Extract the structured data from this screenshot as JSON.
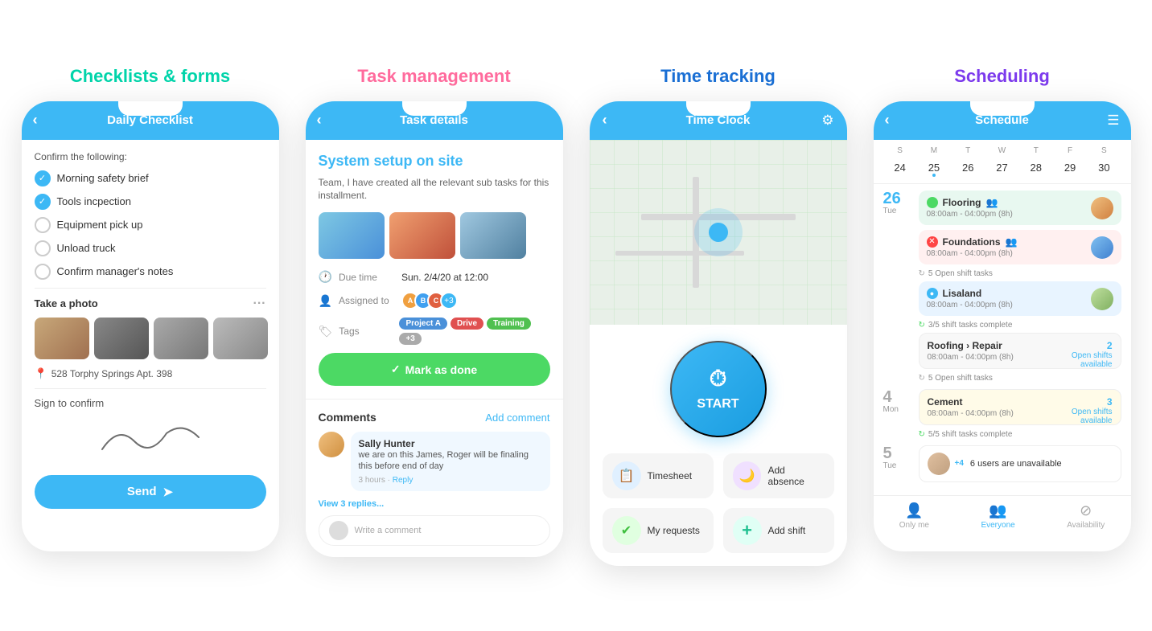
{
  "sections": [
    {
      "id": "checklists",
      "title": "Checklists & forms",
      "titleClass": "title-checklists",
      "phone": {
        "headerTitle": "Daily Checklist",
        "confirmLabel": "Confirm the following:",
        "checkItems": [
          {
            "text": "Morning safety brief",
            "checked": true
          },
          {
            "text": "Tools incpection",
            "checked": true
          },
          {
            "text": "Equipment pick up",
            "checked": false
          },
          {
            "text": "Unload truck",
            "checked": false
          },
          {
            "text": "Confirm manager's notes",
            "checked": false
          }
        ],
        "takePhotoLabel": "Take a photo",
        "locationText": "528 Torphy Springs Apt. 398",
        "signLabel": "Sign to confirm",
        "sendLabel": "Send"
      }
    },
    {
      "id": "task",
      "title": "Task management",
      "titleClass": "title-task",
      "phone": {
        "headerTitle": "Task details",
        "taskTitle": "System setup on site",
        "taskDesc": "Team, I have created all the relevant sub tasks for this installment.",
        "dueLabel": "Due time",
        "dueValue": "Sun. 2/4/20 at 12:00",
        "assignedLabel": "Assigned to",
        "tagsLabel": "Tags",
        "tags": [
          "Project A",
          "Drive",
          "Training",
          "+3"
        ],
        "markDoneLabel": "Mark as done",
        "commentsTitle": "Comments",
        "addCommentLabel": "Add comment",
        "comment": {
          "name": "Sally Hunter",
          "text": "we are on this James, Roger will be finaling this before end of day",
          "time": "3 hours",
          "replyLabel": "Reply",
          "viewReplies": "View 3 replies..."
        },
        "writePlaceholder": "Write a comment"
      }
    },
    {
      "id": "timetracking",
      "title": "Time tracking",
      "titleClass": "title-time",
      "phone": {
        "headerTitle": "Time Clock",
        "startLabel": "START",
        "actions": [
          {
            "label": "Timesheet",
            "iconClass": "icon-blue-light",
            "icon": "📋"
          },
          {
            "label": "Add absence",
            "iconClass": "icon-purple-light",
            "icon": "🌙"
          },
          {
            "label": "My requests",
            "iconClass": "icon-green-light",
            "icon": "✔"
          },
          {
            "label": "Add shift",
            "iconClass": "icon-teal-light",
            "icon": "+"
          }
        ]
      }
    },
    {
      "id": "scheduling",
      "title": "Scheduling",
      "titleClass": "title-scheduling",
      "phone": {
        "headerTitle": "Schedule",
        "calDays": [
          "S",
          "M",
          "T",
          "W",
          "T",
          "F",
          "S"
        ],
        "calDates": [
          {
            "num": "24",
            "dot": false
          },
          {
            "num": "25",
            "dot": true
          },
          {
            "num": "26",
            "dot": false,
            "today": true
          },
          {
            "num": "27",
            "dot": false
          },
          {
            "num": "28",
            "dot": false
          },
          {
            "num": "29",
            "dot": false
          },
          {
            "num": "30",
            "dot": false
          }
        ],
        "scheduleDate": "26",
        "scheduleDateDay": "Tue",
        "scheduleItems": [
          {
            "title": "Flooring",
            "group": "👥",
            "time": "08:00am - 04:00pm (8h)",
            "status": "green",
            "hasAvatar": true
          },
          {
            "title": "Foundations",
            "group": "👥",
            "time": "08:00am - 04:00pm (8h)",
            "status": "red",
            "hasAvatar": true
          },
          {
            "tasks": "5 Open shift tasks"
          }
        ],
        "lisalandItem": {
          "title": "Lisaland",
          "time": "08:00am - 04:00pm (8h)",
          "status": "blue",
          "hasAvatar": true,
          "tasks": "3/5 shift tasks complete"
        },
        "roofingItem": {
          "title": "Roofing › Repair",
          "time": "08:00am - 04:00pm (8h)",
          "openShifts": "2",
          "tasks": "5 Open shift tasks"
        },
        "day4": "4",
        "day4Label": "Mon",
        "cementItem": {
          "title": "Cement",
          "time": "08:00am - 04:00pm (8h)",
          "openShifts": "3",
          "tasks": "5/5 shift tasks complete"
        },
        "day5": "5",
        "day5Label": "Tue",
        "unavailText": "6 users are unavailable",
        "navItems": [
          {
            "label": "Only me",
            "icon": "👤",
            "active": false
          },
          {
            "label": "Everyone",
            "icon": "👥",
            "active": true
          },
          {
            "label": "Availability",
            "icon": "⊘",
            "active": false
          }
        ]
      }
    }
  ]
}
